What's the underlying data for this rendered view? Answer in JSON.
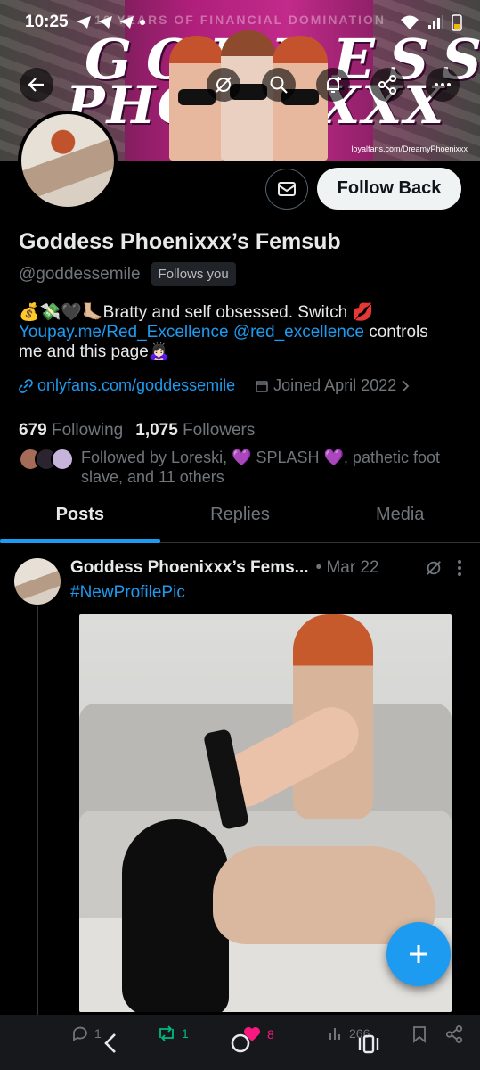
{
  "status_bar": {
    "time": "10:25"
  },
  "banner": {
    "headline": "10 YEARS OF FINANCIAL DOMINATION",
    "title_line1": "GODDESS",
    "title_line2": "PHOENIXXX",
    "watermark": "loyalfans.com/DreamyPhoenixxx"
  },
  "profile": {
    "name": "Goddess Phoenixxx’s Femsub",
    "handle": "@goddessemile",
    "follows_you": "Follows you",
    "bio_emoji": "💰💸🖤🦶🏼",
    "bio_text1": "Bratty and self obsessed. Switch 💋",
    "bio_link1": "Youpay.me/Red_Excellence",
    "bio_link2": "@red_excellence",
    "bio_text2": " controls",
    "bio_text3": "me and this page🙇🏻‍♀️",
    "website": "onlyfans.com/goddessemile",
    "joined": "Joined April 2022",
    "following_count": "679",
    "following_label": "Following",
    "followers_count": "1,075",
    "followers_label": "Followers",
    "followed_by": "Followed by Loreski, 💜 SPLASH 💜, pathetic foot slave, and 11 others"
  },
  "buttons": {
    "follow_back": "Follow Back"
  },
  "tabs": [
    {
      "label": "Posts"
    },
    {
      "label": "Replies"
    },
    {
      "label": "Media"
    }
  ],
  "post": {
    "author": "Goddess Phoenixxx’s Fems...",
    "date": "• Mar 22",
    "hashtag": "#NewProfilePic",
    "replies": "1",
    "reposts": "1",
    "likes": "8",
    "views": "266"
  },
  "colors": {
    "accent": "#1d9bf0",
    "like": "#f91880",
    "repost": "#00ba7c",
    "background": "#000000"
  }
}
